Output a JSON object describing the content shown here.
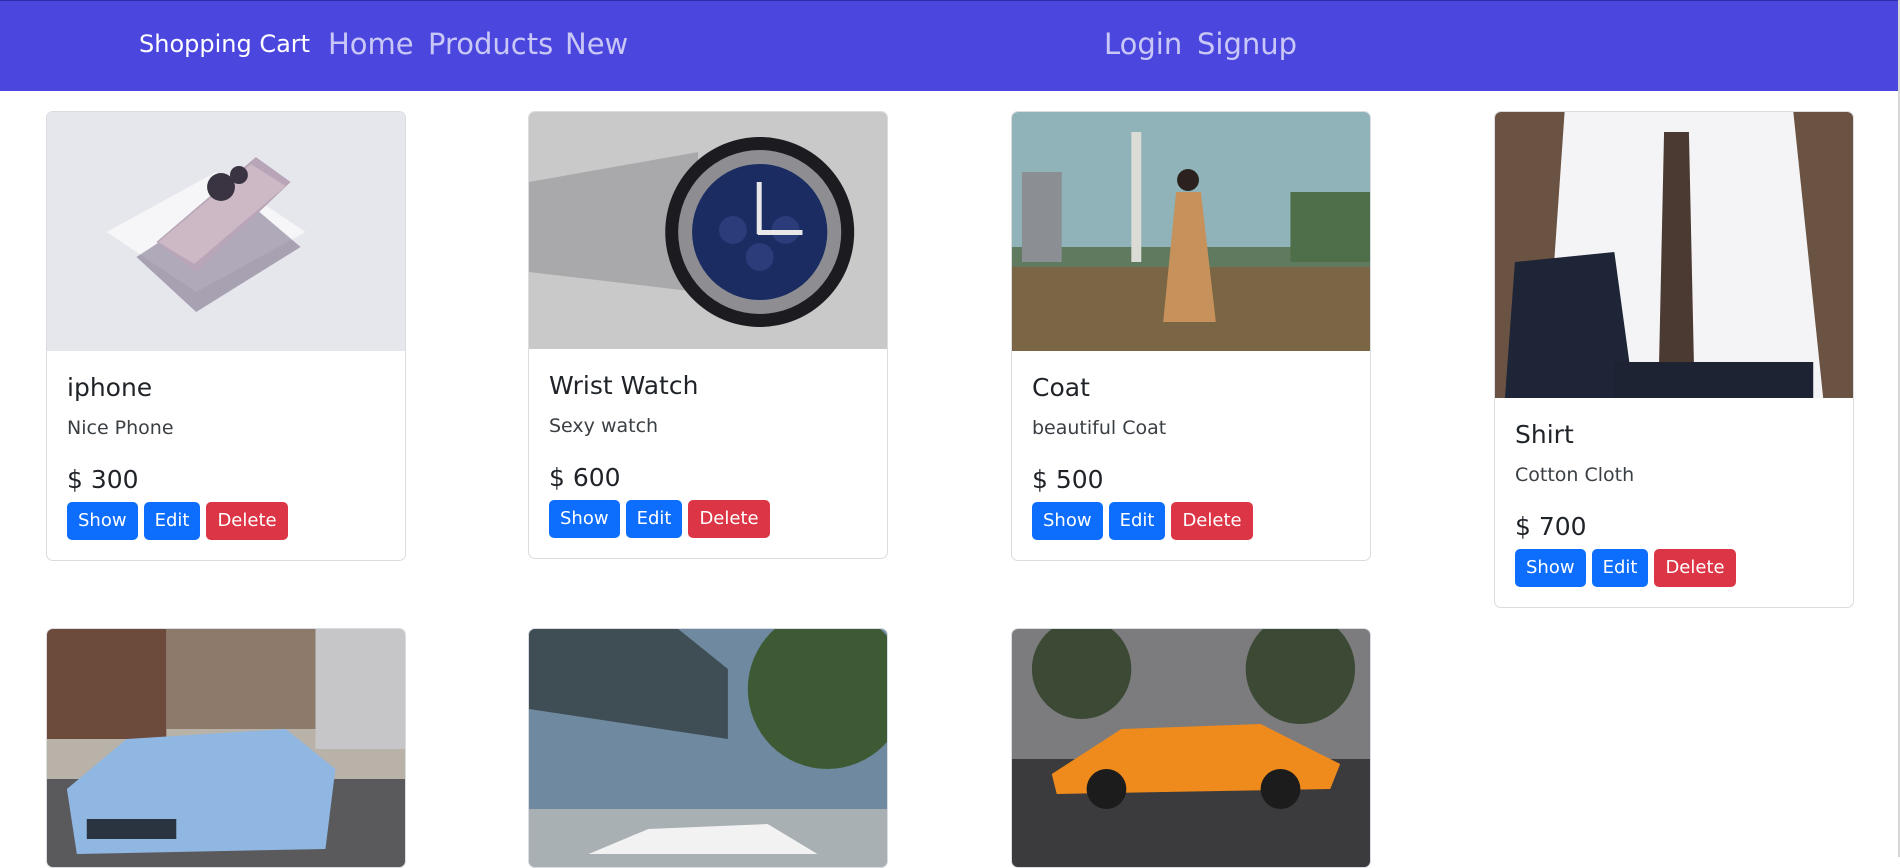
{
  "navbar": {
    "brand": "Shopping Cart",
    "links": [
      "Home",
      "Products",
      "New"
    ],
    "auth": [
      "Login",
      "Signup"
    ],
    "color": "#4b47de"
  },
  "buttons": {
    "show": "Show",
    "edit": "Edit",
    "delete": "Delete"
  },
  "products": [
    {
      "title": "iphone",
      "description": "Nice Phone",
      "price": "$ 300"
    },
    {
      "title": "Wrist Watch",
      "description": "Sexy watch",
      "price": "$ 600"
    },
    {
      "title": "Coat",
      "description": "beautiful Coat",
      "price": "$ 500"
    },
    {
      "title": "Shirt",
      "description": "Cotton Cloth",
      "price": "$ 700"
    }
  ],
  "colors": {
    "primary": "#0d6efd",
    "danger": "#dc3545"
  }
}
